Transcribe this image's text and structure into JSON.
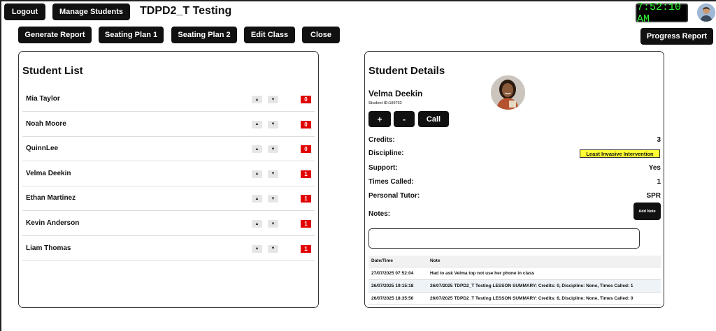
{
  "header": {
    "logout_label": "Logout",
    "manage_students_label": "Manage Students",
    "class_title": "TDPD2_T Testing",
    "clock_time": "7:52:10 AM"
  },
  "toolbar": {
    "generate_report_label": "Generate Report",
    "seating_plan_1_label": "Seating Plan 1",
    "seating_plan_2_label": "Seating Plan 2",
    "edit_class_label": "Edit Class",
    "close_label": "Close",
    "progress_report_label": "Progress Report"
  },
  "student_list": {
    "title": "Student List",
    "students": [
      {
        "name": "Mia Taylor",
        "count": "0"
      },
      {
        "name": "Noah Moore",
        "count": "0"
      },
      {
        "name": "QuinnLee",
        "count": "0"
      },
      {
        "name": "Velma Deekin",
        "count": "1"
      },
      {
        "name": "Ethan Martinez",
        "count": "1"
      },
      {
        "name": "Kevin Anderson",
        "count": "1"
      },
      {
        "name": "Liam Thomas",
        "count": "1"
      }
    ],
    "up_glyph": "▲",
    "down_glyph": "▼"
  },
  "student_details": {
    "title": "Student Details",
    "name": "Velma Deekin",
    "student_id": "Student ID:100753",
    "plus_label": "+",
    "minus_label": "-",
    "call_label": "Call",
    "credits_label": "Credits:",
    "credits_value": "3",
    "discipline_label": "Discipline:",
    "discipline_value": "Least Invasive Intervention",
    "support_label": "Support:",
    "support_value": "Yes",
    "times_called_label": "Times Called:",
    "times_called_value": "1",
    "personal_tutor_label": "Personal Tutor:",
    "personal_tutor_value": "SPR",
    "notes_label": "Notes:",
    "add_note_label": "Add Note",
    "note_input_value": "",
    "notes_table": {
      "headers": [
        "Date/Time",
        "Note"
      ],
      "rows": [
        [
          "27/07/2025 07:52:04",
          "Had to ask Velma top not use her phone in class"
        ],
        [
          "26/07/2025 19:15:18",
          "26/07/2025 TDPD2_T Testing LESSON SUMMARY: Credits: 0, Discipline: None, Times Called: 1"
        ],
        [
          "26/07/2025 18:35:50",
          "26/07/2025 TDPD2_T Testing LESSON SUMMARY: Credits: 6, Discipline: None, Times Called: 0"
        ]
      ]
    }
  },
  "colors": {
    "button_bg": "#111111",
    "badge_red": "#e00000",
    "discipline_yellow": "#ffff33",
    "clock_green": "#33ff33"
  },
  "icons": {
    "user_avatar": "user-avatar-icon",
    "student_photo": "student-photo"
  }
}
